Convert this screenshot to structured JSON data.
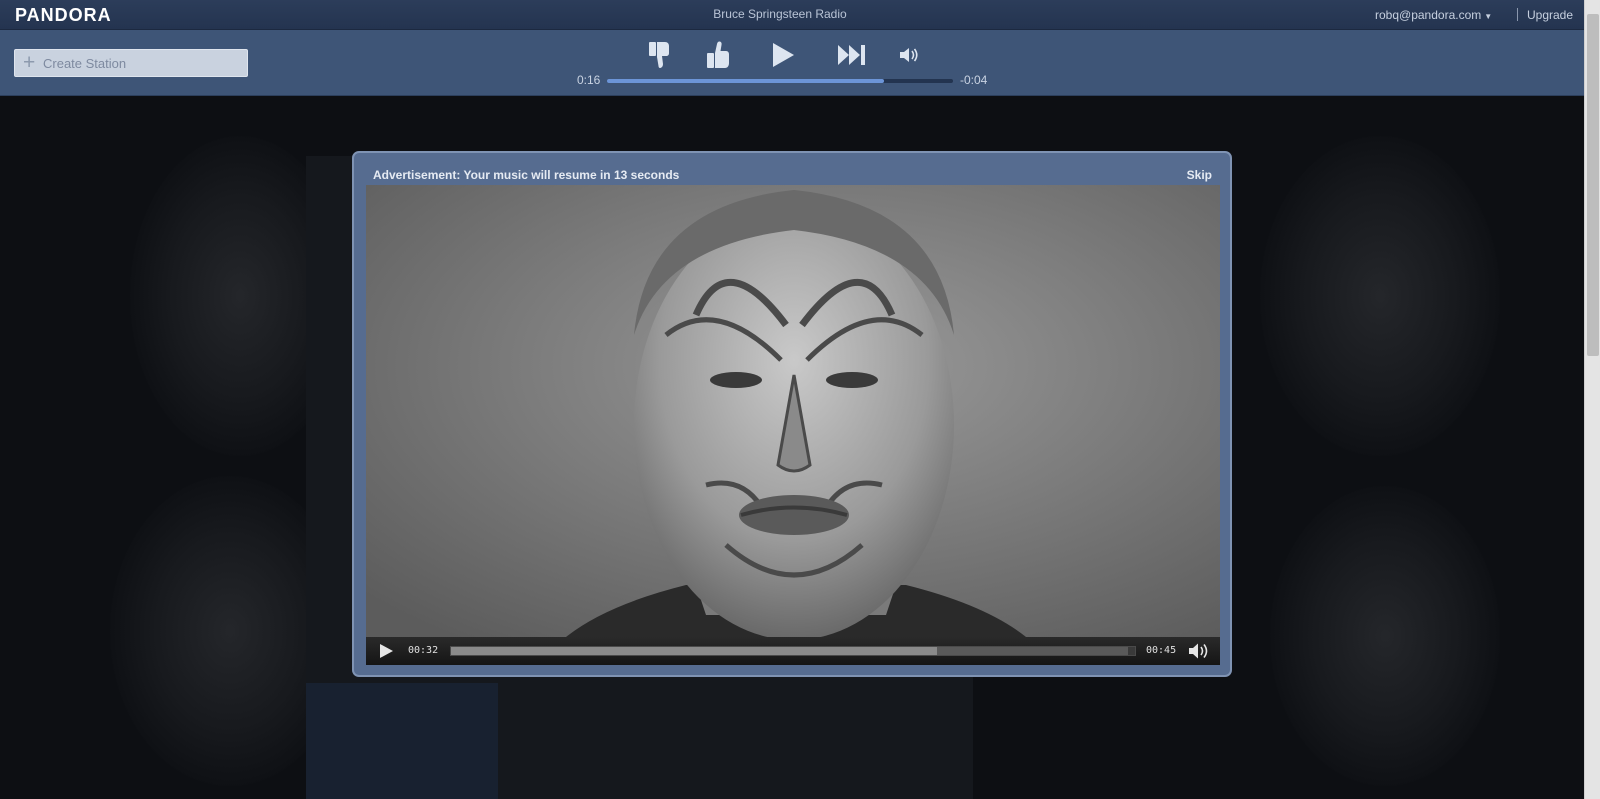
{
  "app": {
    "logo": "PANDORA",
    "station_title": "Bruce Springsteen Radio",
    "user_email": "robq@pandora.com",
    "upgrade_label": "Upgrade"
  },
  "player": {
    "create_station_placeholder": "Create Station",
    "controls": [
      "thumbs-down",
      "thumbs-up",
      "play",
      "skip",
      "volume"
    ],
    "elapsed": "0:16",
    "remaining": "-0:04",
    "progress_fraction": 0.8
  },
  "ad": {
    "message": "Advertisement: Your music will resume in 13 seconds",
    "skip_label": "Skip",
    "video": {
      "elapsed": "00:32",
      "duration": "00:45",
      "played_fraction": 0.71,
      "buffered_fraction": 0.99
    }
  },
  "colors": {
    "header": "#2c3d5a",
    "player_bar": "#3e5577",
    "modal": "#566c90",
    "progress_fill": "#6c95d8"
  }
}
